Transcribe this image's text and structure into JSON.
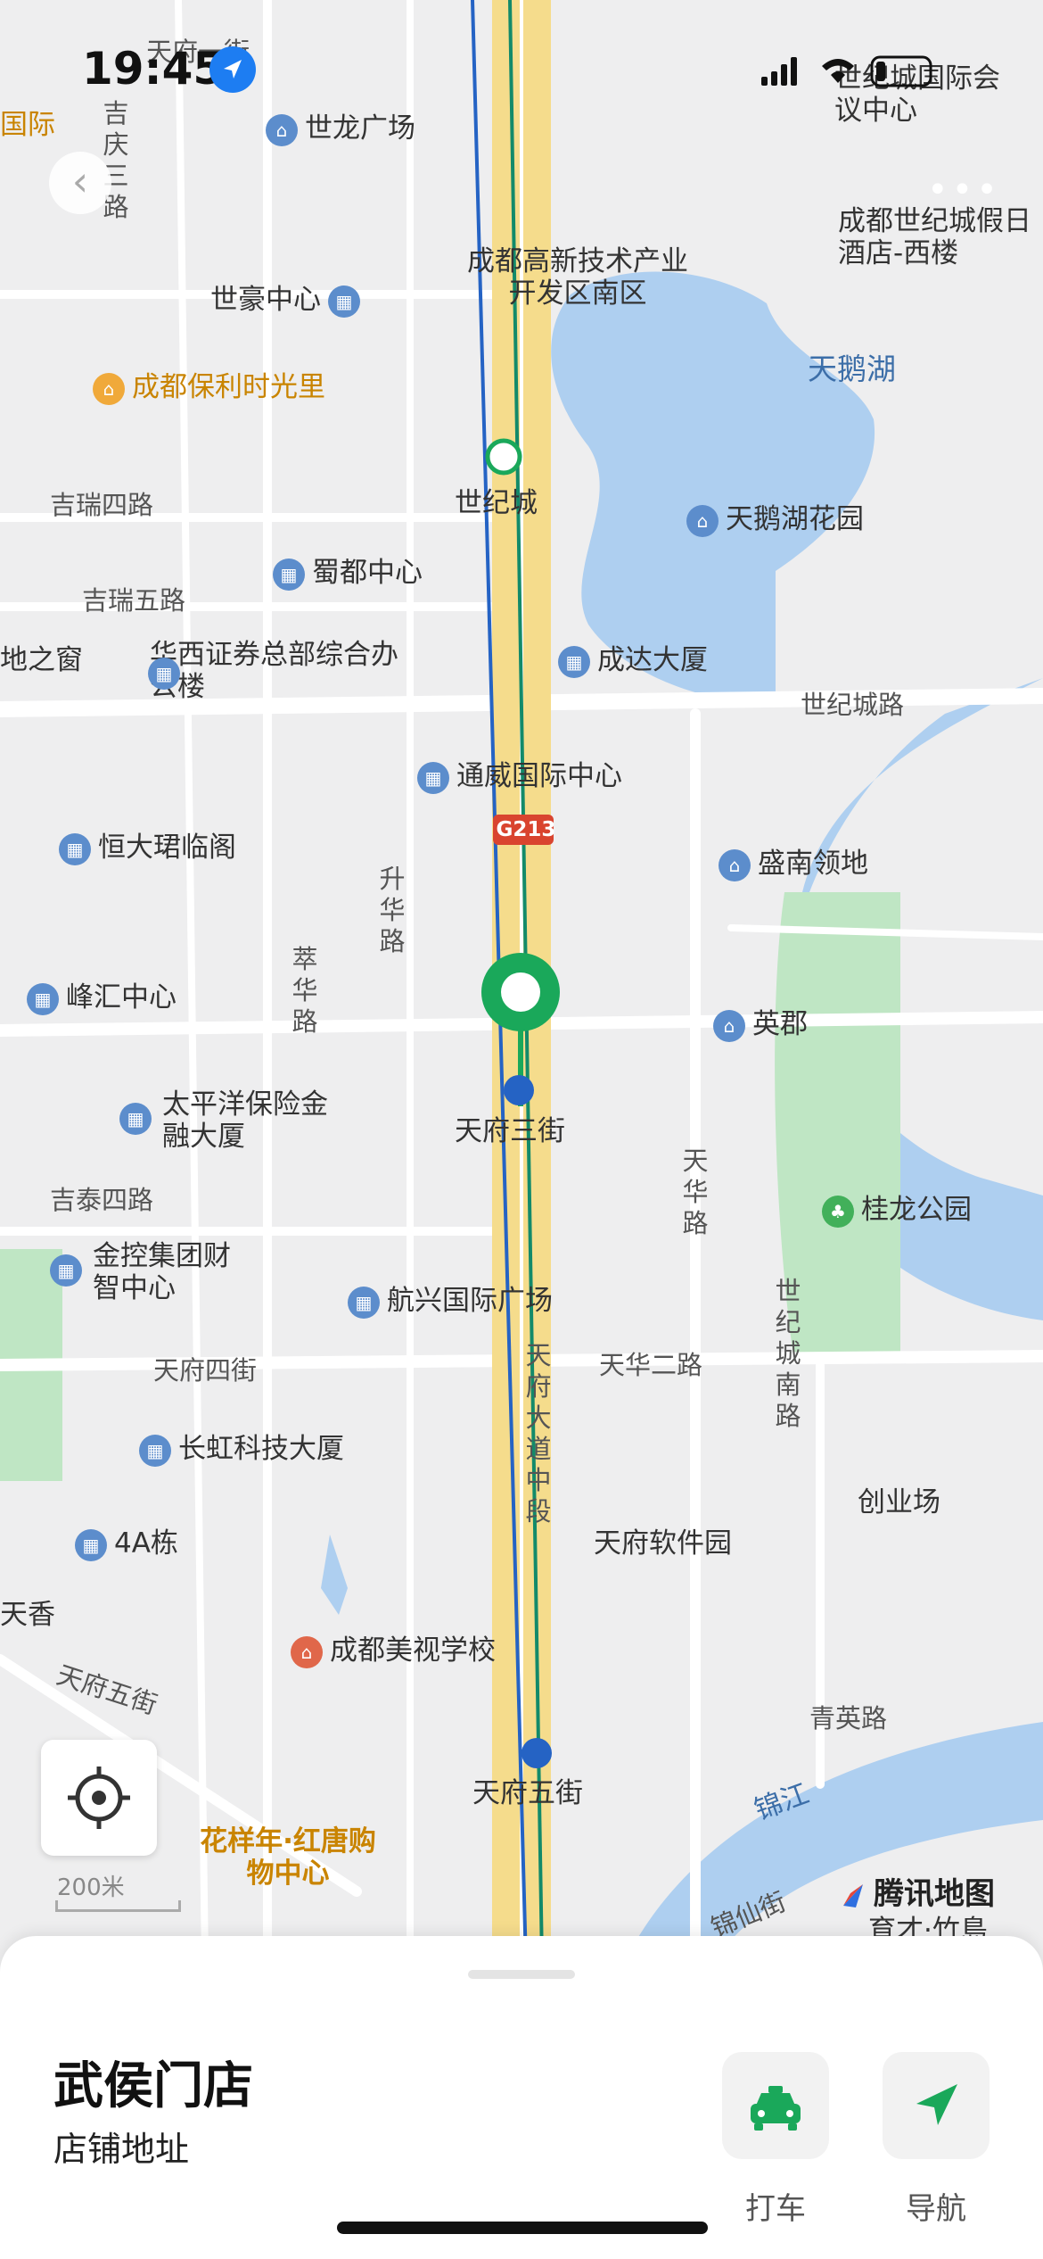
{
  "status_bar": {
    "time": "19:45"
  },
  "map": {
    "shield": "G213",
    "labels": {
      "shijilong": "世龙广场",
      "baoli": "成都保利时光里",
      "shihao": "世豪中心",
      "gaoxin": "成都高新技术产业开发区南区",
      "tianehu": "天鹅湖",
      "tianehu_garden": "天鹅湖花园",
      "shijicheng_station": "世纪城",
      "jirui4": "吉瑞四路",
      "jirui5": "吉瑞五路",
      "shudu": "蜀都中心",
      "huaxi": "华西证券总部综合办公楼",
      "chengda": "成达大厦",
      "shijicheng_rd": "世纪城路",
      "tongwei": "通威国际中心",
      "hengda": "恒大珺临阁",
      "shenghua": "升华路",
      "shengnan": "盛南领地",
      "cuihua": "萃华路",
      "fenghui": "峰汇中心",
      "yingjun": "英郡",
      "taipingyang": "太平洋保险金融大厦",
      "tianfu3": "天府三街",
      "tianhua_rd": "天华路",
      "guilong": "桂龙公园",
      "jitai4": "吉泰四路",
      "jinkong": "金控集团财智中心",
      "hangxing": "航兴国际广场",
      "tianfu4": "天府四街",
      "tianhua2": "天华二路",
      "shijicheng_south": "世纪城南路",
      "changhong": "长虹科技大厦",
      "tianfu_dadao": "天府大道中段",
      "chuangye": "创业场",
      "a4": "4A栋",
      "software_park": "天府软件园",
      "meishi": "成都美视学校",
      "tianfu5_rd": "天府五街",
      "tianfu5_st": "天府五街",
      "qingying": "青英路",
      "jinjiang": "锦江",
      "huayangnian": "花样年·红唐购物中心",
      "jixiang": "吉庆三路",
      "shijicheng_hotel": "成都世纪城假日酒店-西楼",
      "conference": "世纪城国际会议中心",
      "window_fragment": "地之窗",
      "guoji_fragment": "国际",
      "tianxiang_fragment": "天香",
      "tianfu_fragment": "天府一街",
      "jinxian": "锦仙街",
      "yucai": "育才·竹島"
    },
    "scale_text": "200米",
    "watermark": "腾讯地图",
    "colors": {
      "water": "#aecff0",
      "park": "#bfe6c4",
      "road": "#ffffff",
      "highway": "#f5dc8c",
      "route": "#1aa85a"
    }
  },
  "sheet": {
    "store_name": "武侯门店",
    "store_subtitle": "店铺地址",
    "actions": [
      {
        "label": "打车",
        "icon": "taxi-icon"
      },
      {
        "label": "导航",
        "icon": "navigation-icon"
      }
    ]
  }
}
